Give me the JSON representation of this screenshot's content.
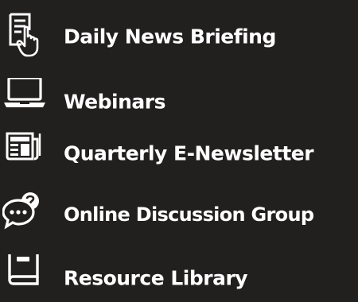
{
  "menu": {
    "items": [
      {
        "label": "Daily News Briefing",
        "icon": "touch-document-icon"
      },
      {
        "label": "Webinars",
        "icon": "laptop-icon"
      },
      {
        "label": "Quarterly E-Newsletter",
        "icon": "newspaper-icon"
      },
      {
        "label": "Online Discussion Group",
        "icon": "chat-bubbles-icon"
      },
      {
        "label": "Resource Library",
        "icon": "book-icon"
      }
    ]
  },
  "colors": {
    "background": "#221f1f",
    "text": "#ffffff",
    "icon": "#ffffff"
  }
}
